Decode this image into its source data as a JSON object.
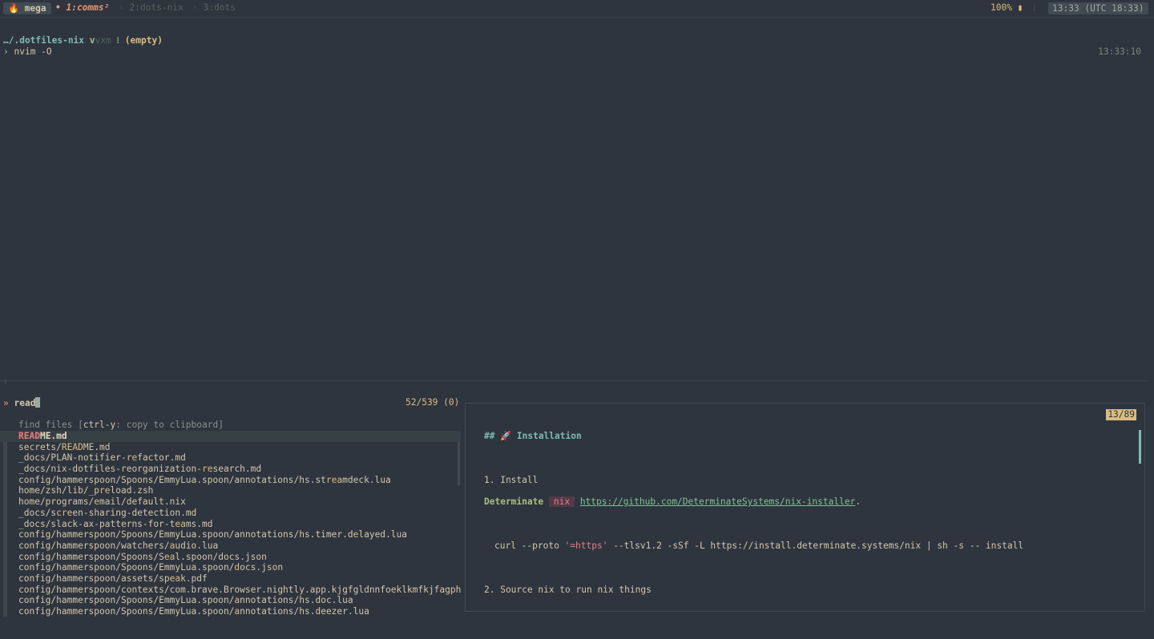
{
  "tmux": {
    "session": "🔥 mega",
    "windows": [
      {
        "label": "• 1:comms²",
        "active": true
      },
      {
        "label": "◦ 2:dots-nix",
        "active": false
      },
      {
        "label": "◦ 3:dots",
        "active": false
      }
    ],
    "battery": "100% ▮",
    "separator": "⁝",
    "clock": "13:33 (UTC 18:33)"
  },
  "shell": {
    "cwd": "…/.dotfiles-nix",
    "vcs_prefix": " v",
    "vcs": "vxm",
    "vcs_sep": " ⁝ ",
    "vcs_status": "(empty)",
    "prompt_symbol": "› ",
    "command": "nvim -O",
    "time": "13:33:10",
    "divider_mark": "↓"
  },
  "picker": {
    "prompt_symbol": "» ",
    "query": "read",
    "counter": "52/539 (0)",
    "header_title": "find files [",
    "header_key": "ctrl-y",
    "header_action": ": copy to clipboard]",
    "results": [
      {
        "pre": "",
        "hl": "READ",
        "post": "ME.md"
      },
      {
        "pre": "secrets/",
        "hl": "READ",
        "post": "ME.md"
      },
      {
        "pre": "_docs/PLAN-notifier-",
        "hl": "re",
        "post": "factor.md"
      },
      {
        "pre": "_docs/nix-dotfiles-reorganization-",
        "hl": "re",
        "post": "search.md"
      },
      {
        "pre": "config/hammerspoon/Spoons/EmmyLua.spoon/annotations/hs.st",
        "hl": "rea",
        "post": "mdeck.lua"
      },
      {
        "pre": "home/zsh/lib/_p",
        "hl": "re",
        "post": "load.zsh"
      },
      {
        "pre": "home/programs/",
        "hl": "e",
        "post": "mail/default.nix"
      },
      {
        "pre": "_docs/sc",
        "hl": "re",
        "post": "en-sharing-detection.md"
      },
      {
        "pre": "_docs/slack-ax-patterns-for-t",
        "hl": "ea",
        "post": "ms.md"
      },
      {
        "pre": "config/hammerspoon/Spoons/EmmyLua.spoon/annotations/hs.timer.d",
        "hl": "e",
        "post": "layed.lua"
      },
      {
        "pre": "config/hammerspoon/watchers/",
        "hl": "a",
        "post": "udio.lua"
      },
      {
        "pre": "config/hammerspoon/Spoons/S",
        "hl": "ea",
        "post": "l.spoon/docs.json"
      },
      {
        "pre": "config/hammerspoon/Spoons/EmmyLua.spoon/",
        "hl": "d",
        "post": "ocs.json"
      },
      {
        "pre": "config/hammerspoon/assets/sp",
        "hl": "ea",
        "post": "k.pdf"
      },
      {
        "pre": "config/hammerspoon/contexts/com.brave.B",
        "hl": "r",
        "post": "owser.nightly.app.kjgfgldnnfoeklkmfkjfagph··"
      },
      {
        "pre": "config/hammerspoon/Spoons/EmmyLua.spoon/",
        "hl": "a",
        "post": "nnotations/hs.doc.lua"
      },
      {
        "pre": "config/hammerspoon/Spoons/EmmyLua.spoon/",
        "hl": "a",
        "post": "nnotations/hs.deezer.lua"
      }
    ]
  },
  "preview": {
    "counter": "13/89",
    "heading": "## 🚀 Installation",
    "step1": "1. Install",
    "det_label": "Determinate",
    "det_tag": "nix",
    "det_link": "https://github.com/DeterminateSystems/nix-installer",
    "det_after": ".",
    "curl_pre": "curl --proto ",
    "curl_str": "'=https'",
    "curl_post": " --tlsv1.2 -sSf -L https://install.determinate.systems/nix | sh -s -- install",
    "step2": "2. Source nix to run nix things"
  }
}
